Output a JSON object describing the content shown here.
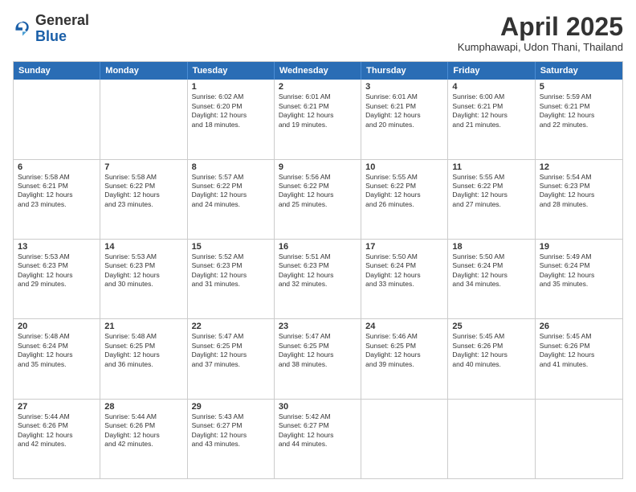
{
  "header": {
    "logo_general": "General",
    "logo_blue": "Blue",
    "month_title": "April 2025",
    "location": "Kumphawapi, Udon Thani, Thailand"
  },
  "calendar": {
    "days": [
      "Sunday",
      "Monday",
      "Tuesday",
      "Wednesday",
      "Thursday",
      "Friday",
      "Saturday"
    ],
    "rows": [
      [
        {
          "day": "",
          "info": ""
        },
        {
          "day": "",
          "info": ""
        },
        {
          "day": "1",
          "info": "Sunrise: 6:02 AM\nSunset: 6:20 PM\nDaylight: 12 hours\nand 18 minutes."
        },
        {
          "day": "2",
          "info": "Sunrise: 6:01 AM\nSunset: 6:21 PM\nDaylight: 12 hours\nand 19 minutes."
        },
        {
          "day": "3",
          "info": "Sunrise: 6:01 AM\nSunset: 6:21 PM\nDaylight: 12 hours\nand 20 minutes."
        },
        {
          "day": "4",
          "info": "Sunrise: 6:00 AM\nSunset: 6:21 PM\nDaylight: 12 hours\nand 21 minutes."
        },
        {
          "day": "5",
          "info": "Sunrise: 5:59 AM\nSunset: 6:21 PM\nDaylight: 12 hours\nand 22 minutes."
        }
      ],
      [
        {
          "day": "6",
          "info": "Sunrise: 5:58 AM\nSunset: 6:21 PM\nDaylight: 12 hours\nand 23 minutes."
        },
        {
          "day": "7",
          "info": "Sunrise: 5:58 AM\nSunset: 6:22 PM\nDaylight: 12 hours\nand 23 minutes."
        },
        {
          "day": "8",
          "info": "Sunrise: 5:57 AM\nSunset: 6:22 PM\nDaylight: 12 hours\nand 24 minutes."
        },
        {
          "day": "9",
          "info": "Sunrise: 5:56 AM\nSunset: 6:22 PM\nDaylight: 12 hours\nand 25 minutes."
        },
        {
          "day": "10",
          "info": "Sunrise: 5:55 AM\nSunset: 6:22 PM\nDaylight: 12 hours\nand 26 minutes."
        },
        {
          "day": "11",
          "info": "Sunrise: 5:55 AM\nSunset: 6:22 PM\nDaylight: 12 hours\nand 27 minutes."
        },
        {
          "day": "12",
          "info": "Sunrise: 5:54 AM\nSunset: 6:23 PM\nDaylight: 12 hours\nand 28 minutes."
        }
      ],
      [
        {
          "day": "13",
          "info": "Sunrise: 5:53 AM\nSunset: 6:23 PM\nDaylight: 12 hours\nand 29 minutes."
        },
        {
          "day": "14",
          "info": "Sunrise: 5:53 AM\nSunset: 6:23 PM\nDaylight: 12 hours\nand 30 minutes."
        },
        {
          "day": "15",
          "info": "Sunrise: 5:52 AM\nSunset: 6:23 PM\nDaylight: 12 hours\nand 31 minutes."
        },
        {
          "day": "16",
          "info": "Sunrise: 5:51 AM\nSunset: 6:23 PM\nDaylight: 12 hours\nand 32 minutes."
        },
        {
          "day": "17",
          "info": "Sunrise: 5:50 AM\nSunset: 6:24 PM\nDaylight: 12 hours\nand 33 minutes."
        },
        {
          "day": "18",
          "info": "Sunrise: 5:50 AM\nSunset: 6:24 PM\nDaylight: 12 hours\nand 34 minutes."
        },
        {
          "day": "19",
          "info": "Sunrise: 5:49 AM\nSunset: 6:24 PM\nDaylight: 12 hours\nand 35 minutes."
        }
      ],
      [
        {
          "day": "20",
          "info": "Sunrise: 5:48 AM\nSunset: 6:24 PM\nDaylight: 12 hours\nand 35 minutes."
        },
        {
          "day": "21",
          "info": "Sunrise: 5:48 AM\nSunset: 6:25 PM\nDaylight: 12 hours\nand 36 minutes."
        },
        {
          "day": "22",
          "info": "Sunrise: 5:47 AM\nSunset: 6:25 PM\nDaylight: 12 hours\nand 37 minutes."
        },
        {
          "day": "23",
          "info": "Sunrise: 5:47 AM\nSunset: 6:25 PM\nDaylight: 12 hours\nand 38 minutes."
        },
        {
          "day": "24",
          "info": "Sunrise: 5:46 AM\nSunset: 6:25 PM\nDaylight: 12 hours\nand 39 minutes."
        },
        {
          "day": "25",
          "info": "Sunrise: 5:45 AM\nSunset: 6:26 PM\nDaylight: 12 hours\nand 40 minutes."
        },
        {
          "day": "26",
          "info": "Sunrise: 5:45 AM\nSunset: 6:26 PM\nDaylight: 12 hours\nand 41 minutes."
        }
      ],
      [
        {
          "day": "27",
          "info": "Sunrise: 5:44 AM\nSunset: 6:26 PM\nDaylight: 12 hours\nand 42 minutes."
        },
        {
          "day": "28",
          "info": "Sunrise: 5:44 AM\nSunset: 6:26 PM\nDaylight: 12 hours\nand 42 minutes."
        },
        {
          "day": "29",
          "info": "Sunrise: 5:43 AM\nSunset: 6:27 PM\nDaylight: 12 hours\nand 43 minutes."
        },
        {
          "day": "30",
          "info": "Sunrise: 5:42 AM\nSunset: 6:27 PM\nDaylight: 12 hours\nand 44 minutes."
        },
        {
          "day": "",
          "info": ""
        },
        {
          "day": "",
          "info": ""
        },
        {
          "day": "",
          "info": ""
        }
      ]
    ]
  }
}
